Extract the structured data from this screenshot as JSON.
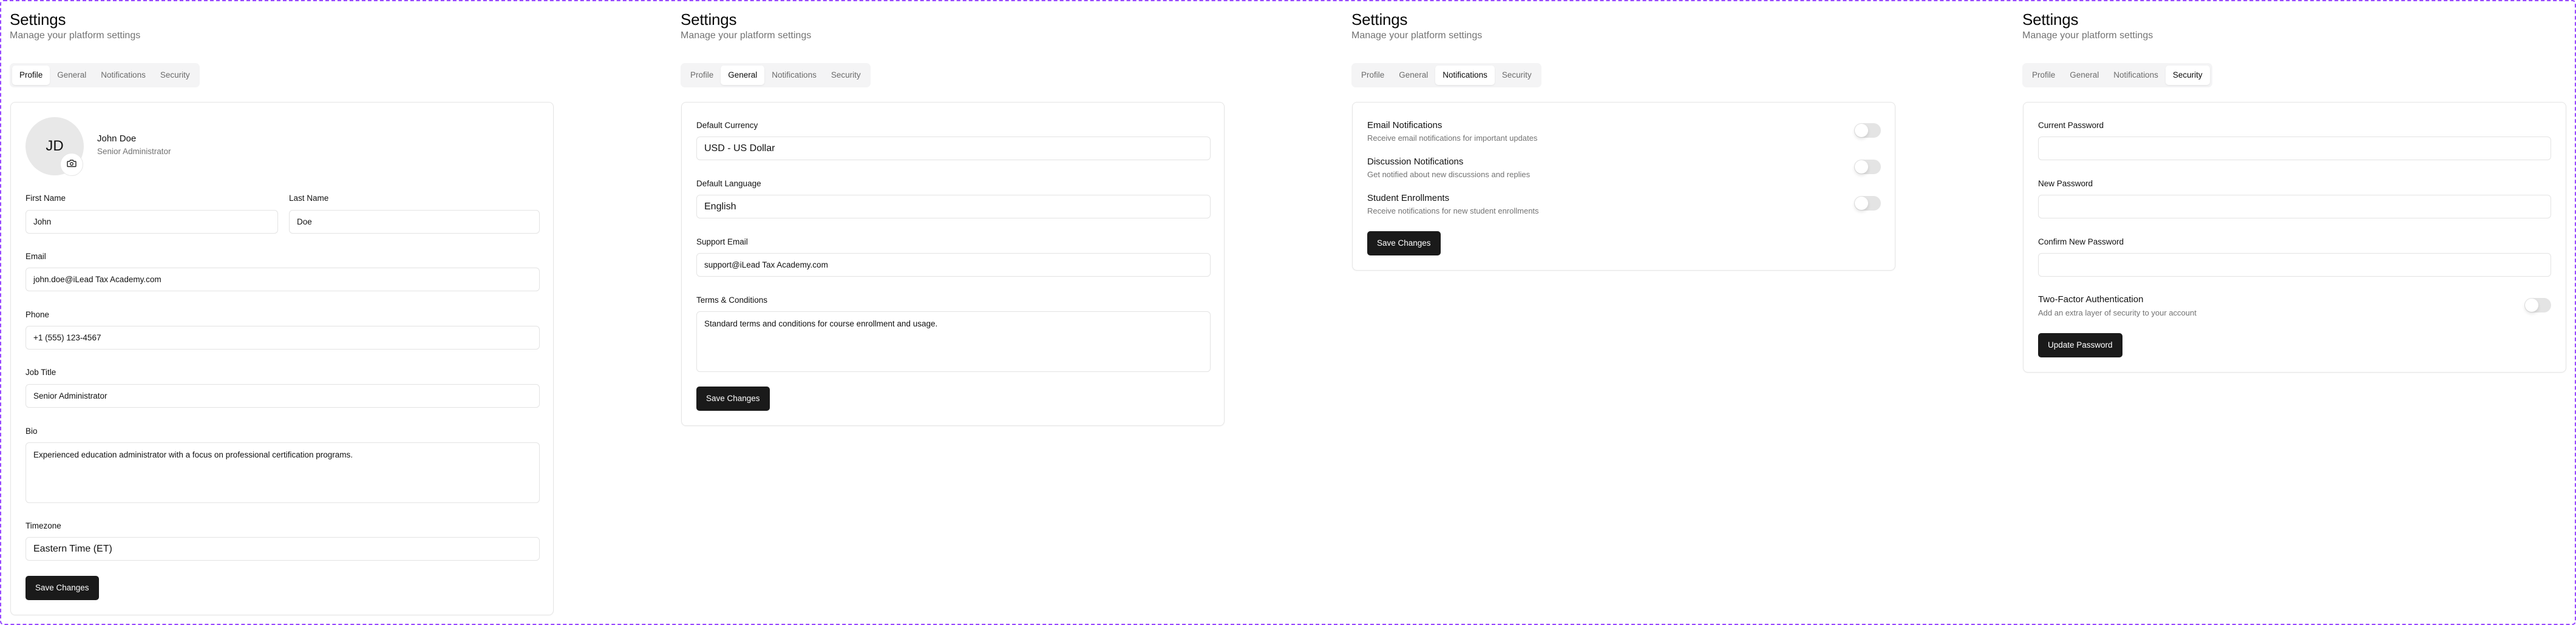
{
  "page": {
    "title": "Settings",
    "subtitle": "Manage your platform settings"
  },
  "tabs": [
    "Profile",
    "General",
    "Notifications",
    "Security"
  ],
  "panels": {
    "profile": {
      "active_tab": "Profile",
      "avatar_initials": "JD",
      "avatar_icon": "camera-icon",
      "user_name": "John Doe",
      "user_role": "Senior Administrator",
      "fields": {
        "first_name": {
          "label": "First Name",
          "value": "John"
        },
        "last_name": {
          "label": "Last Name",
          "value": "Doe"
        },
        "email": {
          "label": "Email",
          "value": "john.doe@iLead Tax Academy.com"
        },
        "phone": {
          "label": "Phone",
          "value": "+1 (555) 123-4567"
        },
        "job_title": {
          "label": "Job Title",
          "value": "Senior Administrator"
        },
        "bio": {
          "label": "Bio",
          "value": "Experienced education administrator with a focus on professional certification programs."
        },
        "timezone": {
          "label": "Timezone",
          "value": "Eastern Time (ET)"
        }
      },
      "save_label": "Save Changes"
    },
    "general": {
      "active_tab": "General",
      "fields": {
        "currency": {
          "label": "Default Currency",
          "value": "USD - US Dollar"
        },
        "language": {
          "label": "Default Language",
          "value": "English"
        },
        "support_email": {
          "label": "Support Email",
          "value": "support@iLead Tax Academy.com"
        },
        "terms": {
          "label": "Terms & Conditions",
          "value": "Standard terms and conditions for course enrollment and usage."
        }
      },
      "save_label": "Save Changes"
    },
    "notifications": {
      "active_tab": "Notifications",
      "items": [
        {
          "title": "Email Notifications",
          "description": "Receive email notifications for important updates",
          "enabled": false
        },
        {
          "title": "Discussion Notifications",
          "description": "Get notified about new discussions and replies",
          "enabled": false
        },
        {
          "title": "Student Enrollments",
          "description": "Receive notifications for new student enrollments",
          "enabled": false
        }
      ],
      "save_label": "Save Changes"
    },
    "security": {
      "active_tab": "Security",
      "fields": {
        "current_password": {
          "label": "Current Password",
          "value": ""
        },
        "new_password": {
          "label": "New Password",
          "value": ""
        },
        "confirm_password": {
          "label": "Confirm New Password",
          "value": ""
        }
      },
      "two_factor": {
        "title": "Two-Factor Authentication",
        "description": "Add an extra layer of security to your account",
        "enabled": false
      },
      "update_label": "Update Password"
    }
  },
  "colors": {
    "frame_border": "#9747ff",
    "primary_button": "#1a1a1a",
    "tab_bar_bg": "#f4f4f5",
    "muted_text": "#737373",
    "toggle_off": "#e4e4e4"
  }
}
